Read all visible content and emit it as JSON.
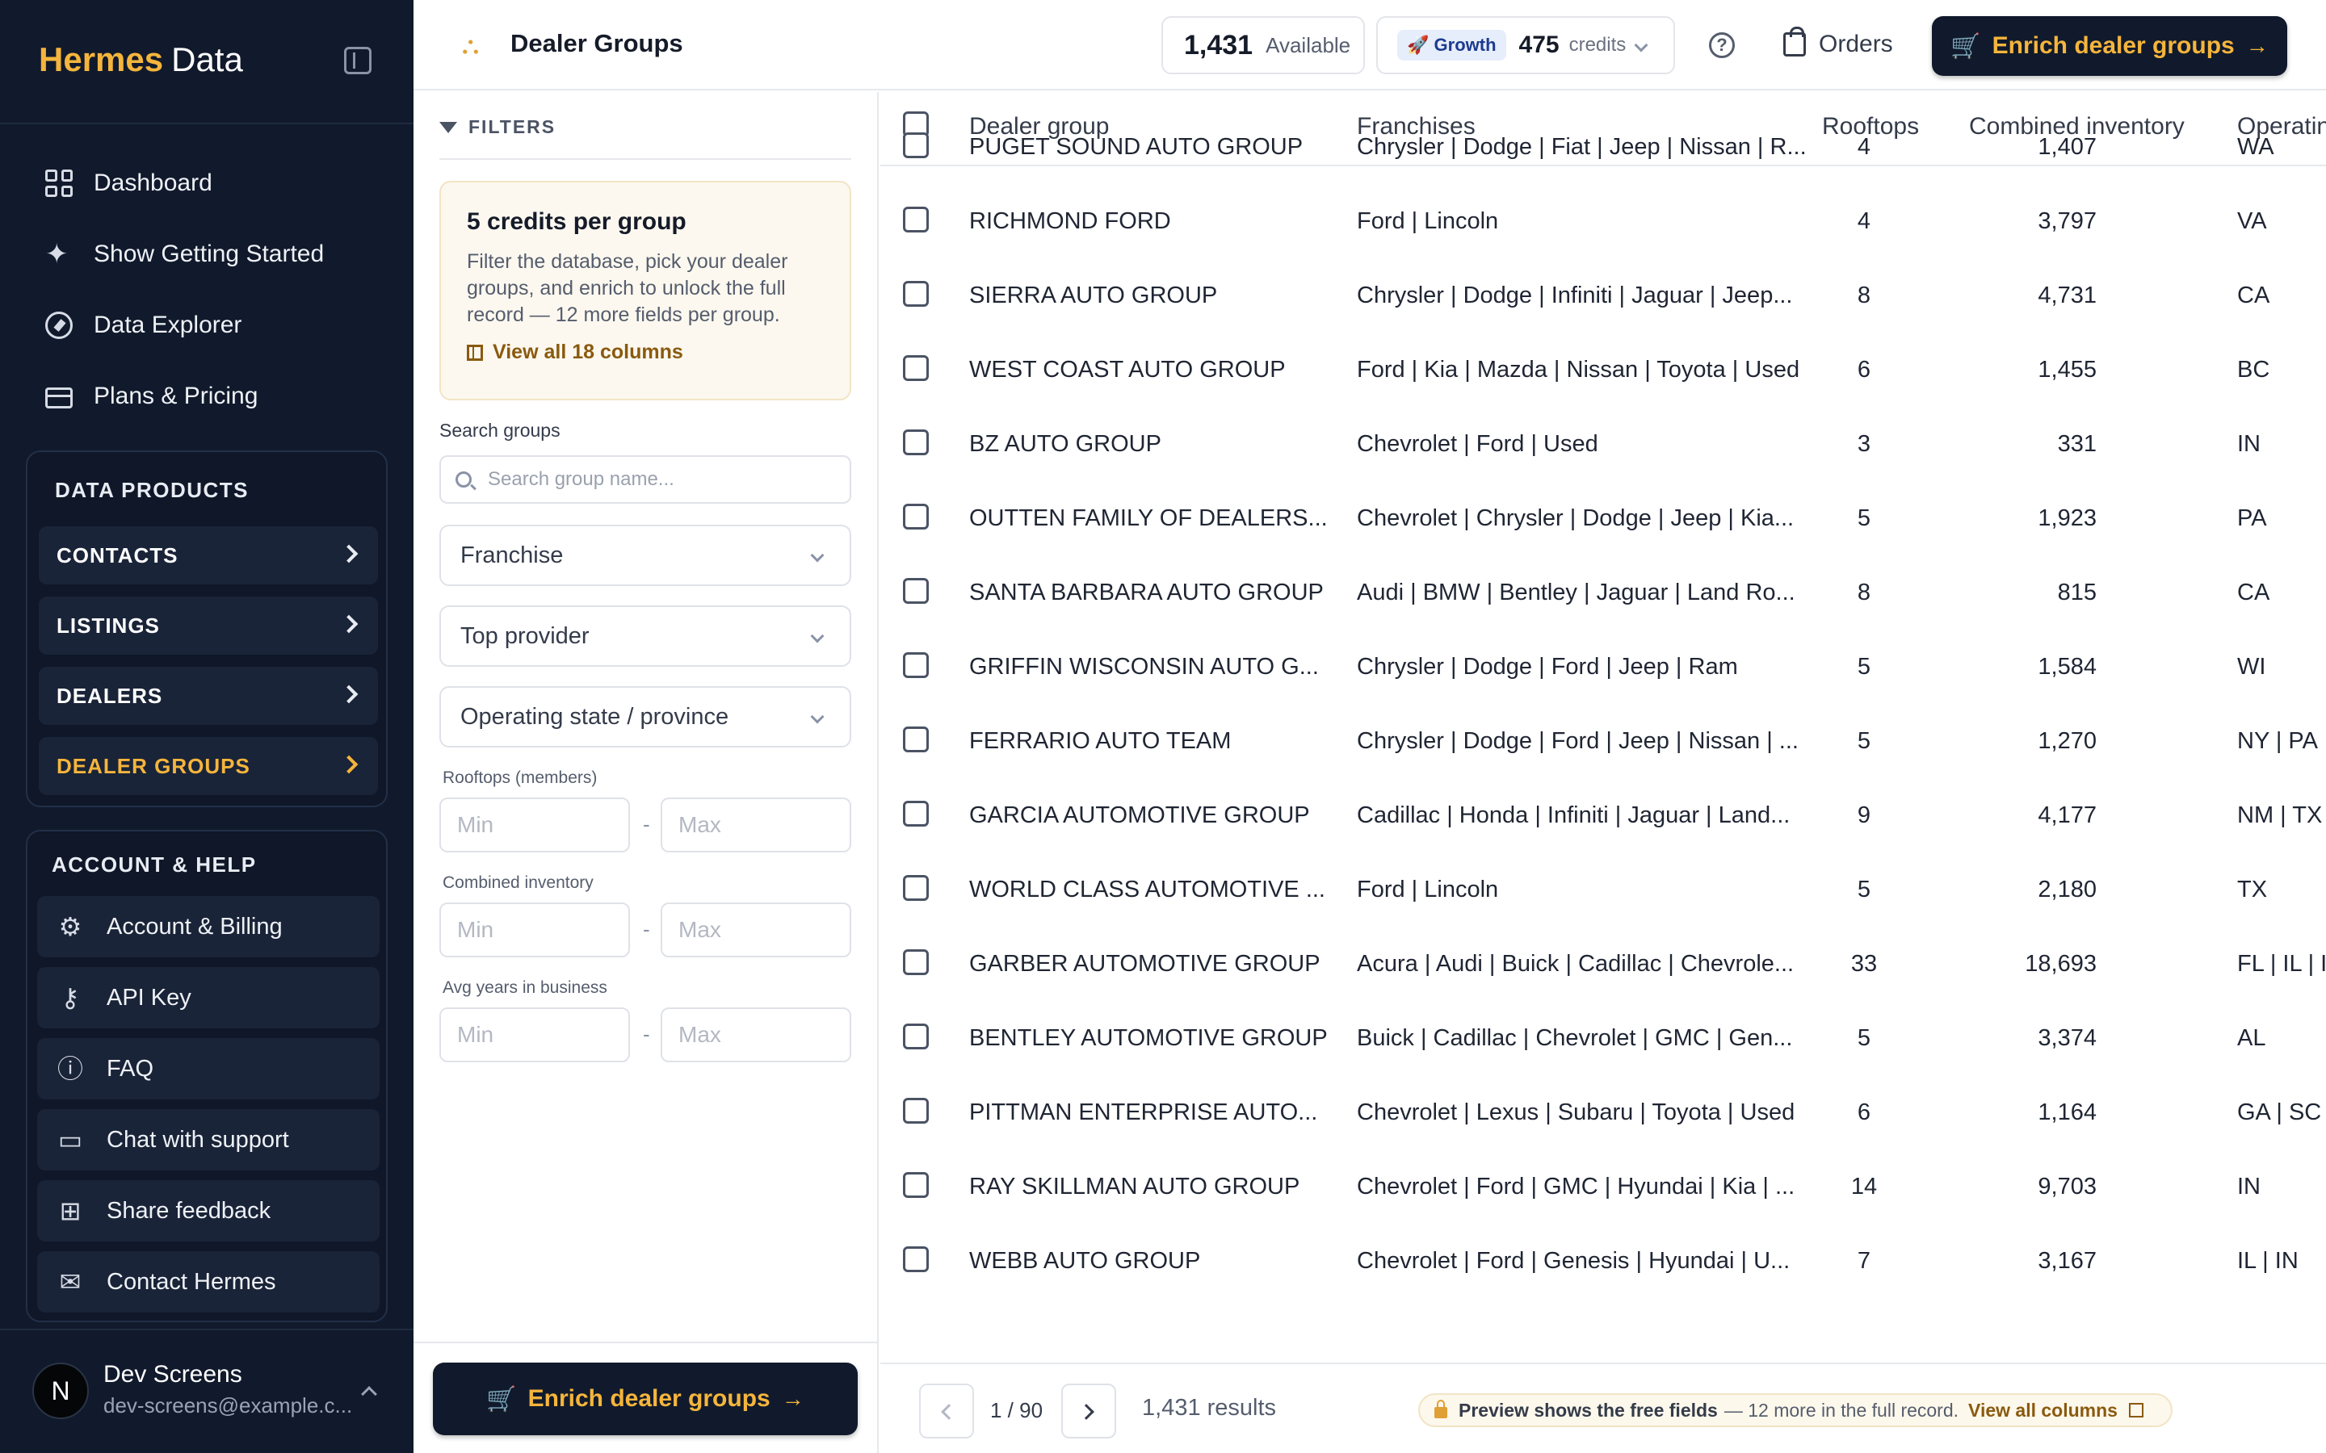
{
  "brand": {
    "part1": "Hermes",
    "part2": "Data"
  },
  "nav": [
    {
      "label": "Dashboard",
      "icon": "grid-icon"
    },
    {
      "label": "Show Getting Started",
      "icon": "sparkle-icon"
    },
    {
      "label": "Data Explorer",
      "icon": "compass-icon"
    },
    {
      "label": "Plans & Pricing",
      "icon": "card-icon"
    }
  ],
  "data_products": {
    "title": "DATA PRODUCTS",
    "items": [
      {
        "label": "CONTACTS",
        "active": false
      },
      {
        "label": "LISTINGS",
        "active": false
      },
      {
        "label": "DEALERS",
        "active": false
      },
      {
        "label": "DEALER GROUPS",
        "active": true
      }
    ]
  },
  "account": {
    "title": "ACCOUNT & HELP",
    "items": [
      {
        "label": "Account & Billing",
        "icon": "gear-icon"
      },
      {
        "label": "API Key",
        "icon": "key-icon"
      },
      {
        "label": "FAQ",
        "icon": "help-circle-icon"
      },
      {
        "label": "Chat with support",
        "icon": "chat-icon"
      },
      {
        "label": "Share feedback",
        "icon": "feedback-icon"
      },
      {
        "label": "Contact Hermes",
        "icon": "mail-icon"
      }
    ]
  },
  "user": {
    "initial": "N",
    "name": "Dev Screens",
    "email": "dev-screens@example.c..."
  },
  "header": {
    "title": "Dealer Groups",
    "available_count": "1,431",
    "available_label": "Available",
    "plan": "Growth",
    "credits": "475",
    "credits_label": "credits",
    "orders_label": "Orders",
    "enrich_label": "Enrich dealer groups"
  },
  "filters": {
    "heading": "FILTERS",
    "card_title": "5 credits per group",
    "card_desc": "Filter the database, pick your dealer groups, and enrich to unlock the full record — 12 more fields per group.",
    "card_link": "View all 18 columns",
    "search_label": "Search groups",
    "search_placeholder": "Search group name...",
    "selects": [
      "Franchise",
      "Top provider",
      "Operating state / province"
    ],
    "ranges": [
      {
        "label": "Rooftops (members)",
        "min_placeholder": "Min",
        "max_placeholder": "Max"
      },
      {
        "label": "Combined inventory",
        "min_placeholder": "Min",
        "max_placeholder": "Max"
      },
      {
        "label": "Avg years in business",
        "min_placeholder": "Min",
        "max_placeholder": "Max"
      }
    ],
    "enrich_label": "Enrich dealer groups"
  },
  "table": {
    "columns": [
      "Dealer group",
      "Franchises",
      "Rooftops",
      "Combined inventory",
      "Operatin"
    ],
    "rows": [
      {
        "group": "PUGET SOUND AUTO GROUP",
        "franchises": "Chrysler | Dodge | Fiat | Jeep | Nissan | R...",
        "rooftops": "4",
        "inventory": "1,407",
        "state": "WA"
      },
      {
        "group": "RICHMOND FORD",
        "franchises": "Ford | Lincoln",
        "rooftops": "4",
        "inventory": "3,797",
        "state": "VA"
      },
      {
        "group": "SIERRA AUTO GROUP",
        "franchises": "Chrysler | Dodge | Infiniti | Jaguar | Jeep...",
        "rooftops": "8",
        "inventory": "4,731",
        "state": "CA"
      },
      {
        "group": "WEST COAST AUTO GROUP",
        "franchises": "Ford | Kia | Mazda | Nissan | Toyota | Used",
        "rooftops": "6",
        "inventory": "1,455",
        "state": "BC"
      },
      {
        "group": "BZ AUTO GROUP",
        "franchises": "Chevrolet | Ford | Used",
        "rooftops": "3",
        "inventory": "331",
        "state": "IN"
      },
      {
        "group": "OUTTEN FAMILY OF DEALERS...",
        "franchises": "Chevrolet | Chrysler | Dodge | Jeep | Kia...",
        "rooftops": "5",
        "inventory": "1,923",
        "state": "PA"
      },
      {
        "group": "SANTA BARBARA AUTO GROUP",
        "franchises": "Audi | BMW | Bentley | Jaguar | Land Ro...",
        "rooftops": "8",
        "inventory": "815",
        "state": "CA"
      },
      {
        "group": "GRIFFIN WISCONSIN AUTO G...",
        "franchises": "Chrysler | Dodge | Ford | Jeep | Ram",
        "rooftops": "5",
        "inventory": "1,584",
        "state": "WI"
      },
      {
        "group": "FERRARIO AUTO TEAM",
        "franchises": "Chrysler | Dodge | Ford | Jeep | Nissan | ...",
        "rooftops": "5",
        "inventory": "1,270",
        "state": "NY | PA"
      },
      {
        "group": "GARCIA AUTOMOTIVE GROUP",
        "franchises": "Cadillac | Honda | Infiniti | Jaguar | Land...",
        "rooftops": "9",
        "inventory": "4,177",
        "state": "NM | TX"
      },
      {
        "group": "WORLD CLASS AUTOMOTIVE ...",
        "franchises": "Ford | Lincoln",
        "rooftops": "5",
        "inventory": "2,180",
        "state": "TX"
      },
      {
        "group": "GARBER AUTOMOTIVE GROUP",
        "franchises": "Acura | Audi | Buick | Cadillac | Chevrole...",
        "rooftops": "33",
        "inventory": "18,693",
        "state": "FL | IL | IN"
      },
      {
        "group": "BENTLEY AUTOMOTIVE GROUP",
        "franchises": "Buick | Cadillac | Chevrolet | GMC | Gen...",
        "rooftops": "5",
        "inventory": "3,374",
        "state": "AL"
      },
      {
        "group": "PITTMAN ENTERPRISE AUTO...",
        "franchises": "Chevrolet | Lexus | Subaru | Toyota | Used",
        "rooftops": "6",
        "inventory": "1,164",
        "state": "GA | SC"
      },
      {
        "group": "RAY SKILLMAN AUTO GROUP",
        "franchises": "Chevrolet | Ford | GMC | Hyundai | Kia | ...",
        "rooftops": "14",
        "inventory": "9,703",
        "state": "IN"
      },
      {
        "group": "WEBB AUTO GROUP",
        "franchises": "Chevrolet | Ford | Genesis | Hyundai | U...",
        "rooftops": "7",
        "inventory": "3,167",
        "state": "IL | IN"
      }
    ]
  },
  "pager": {
    "page_text": "1 / 90",
    "results": "1,431 results",
    "preview_bold": "Preview shows the free fields",
    "preview_rest": " — 12 more in the full record.",
    "preview_link": "View all columns"
  },
  "colors": {
    "sidebar_bg": "#111a2c",
    "accent": "#f5b53c",
    "link": "#8a5a0f"
  }
}
